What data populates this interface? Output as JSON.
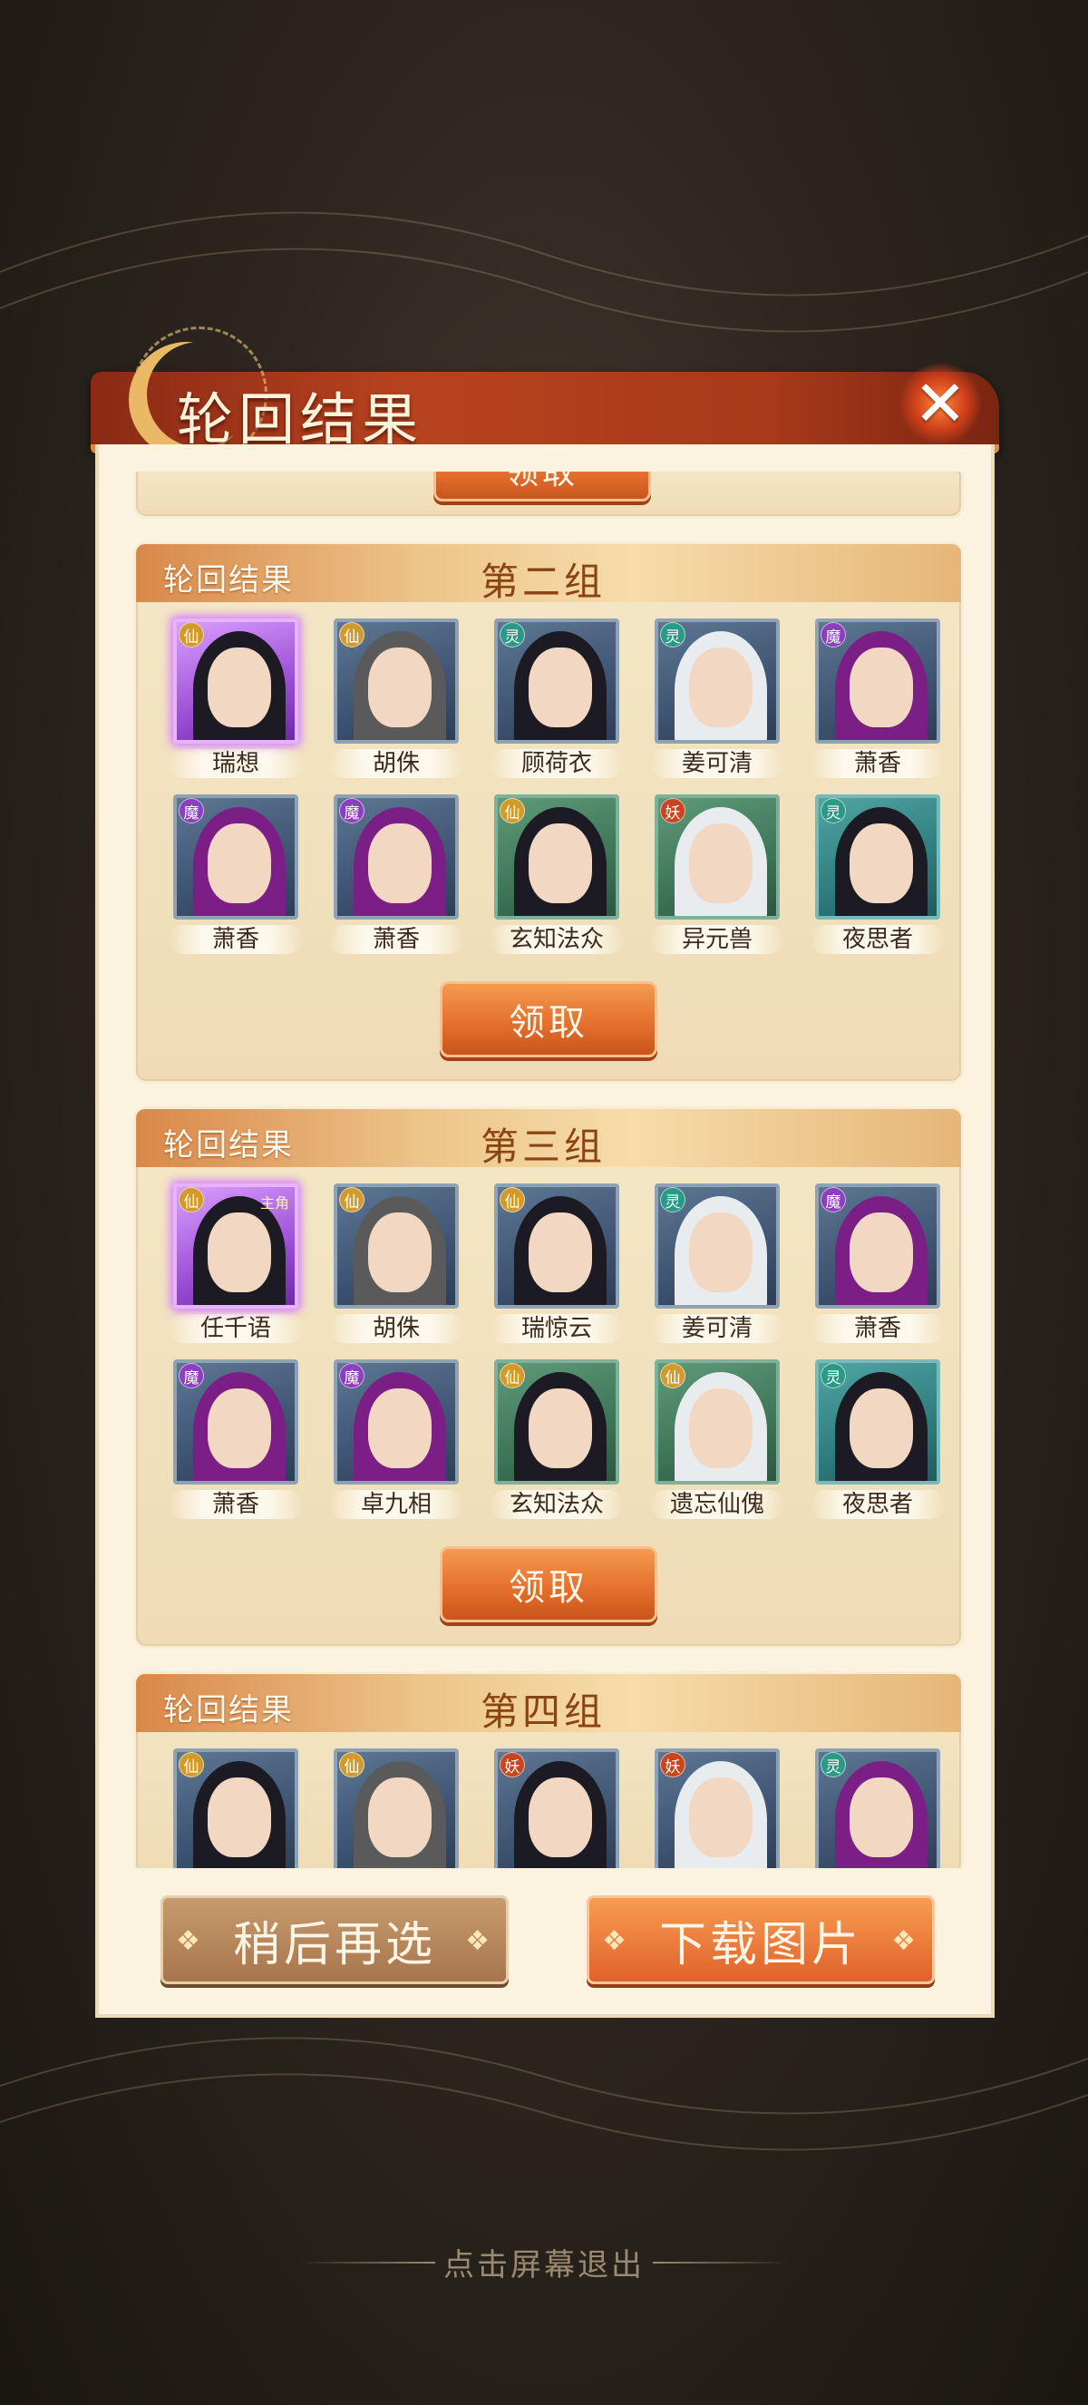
{
  "dialog": {
    "title": "轮回结果",
    "close_icon": "close-x-icon"
  },
  "top_partial": {
    "claim_label": "领取"
  },
  "groups": [
    {
      "label": "轮回结果",
      "name": "第二组",
      "claim_label": "领取",
      "characters": [
        {
          "name": "瑞想",
          "faction": "仙"
        },
        {
          "name": "胡侏",
          "faction": "仙"
        },
        {
          "name": "顾荷衣",
          "faction": "灵"
        },
        {
          "name": "姜可清",
          "faction": "灵"
        },
        {
          "name": "萧香",
          "faction": "魔"
        },
        {
          "name": "萧香",
          "faction": "魔"
        },
        {
          "name": "萧香",
          "faction": "魔"
        },
        {
          "name": "玄知法众",
          "faction": "仙"
        },
        {
          "name": "异元兽",
          "faction": "妖"
        },
        {
          "name": "夜思者",
          "faction": "灵"
        }
      ]
    },
    {
      "label": "轮回结果",
      "name": "第三组",
      "claim_label": "领取",
      "characters": [
        {
          "name": "任千语",
          "faction": "仙",
          "tag": "主角"
        },
        {
          "name": "胡侏",
          "faction": "仙"
        },
        {
          "name": "瑞惊云",
          "faction": "仙"
        },
        {
          "name": "姜可清",
          "faction": "灵"
        },
        {
          "name": "萧香",
          "faction": "魔"
        },
        {
          "name": "萧香",
          "faction": "魔"
        },
        {
          "name": "卓九相",
          "faction": "魔"
        },
        {
          "name": "玄知法众",
          "faction": "仙"
        },
        {
          "name": "遗忘仙傀",
          "faction": "仙"
        },
        {
          "name": "夜思者",
          "faction": "灵"
        }
      ]
    },
    {
      "label": "轮回结果",
      "name": "第四组",
      "characters": [
        {
          "faction": "仙"
        },
        {
          "faction": "仙"
        },
        {
          "faction": "妖"
        },
        {
          "faction": "妖"
        },
        {
          "faction": "灵"
        }
      ]
    }
  ],
  "footer": {
    "later_label": "稍后再选",
    "download_label": "下载图片",
    "exit_hint": "点击屏幕退出"
  },
  "colors": {
    "accent_orange": "#e36d2b",
    "title_red": "#b8421f",
    "panel_cream": "#fbf3df"
  }
}
